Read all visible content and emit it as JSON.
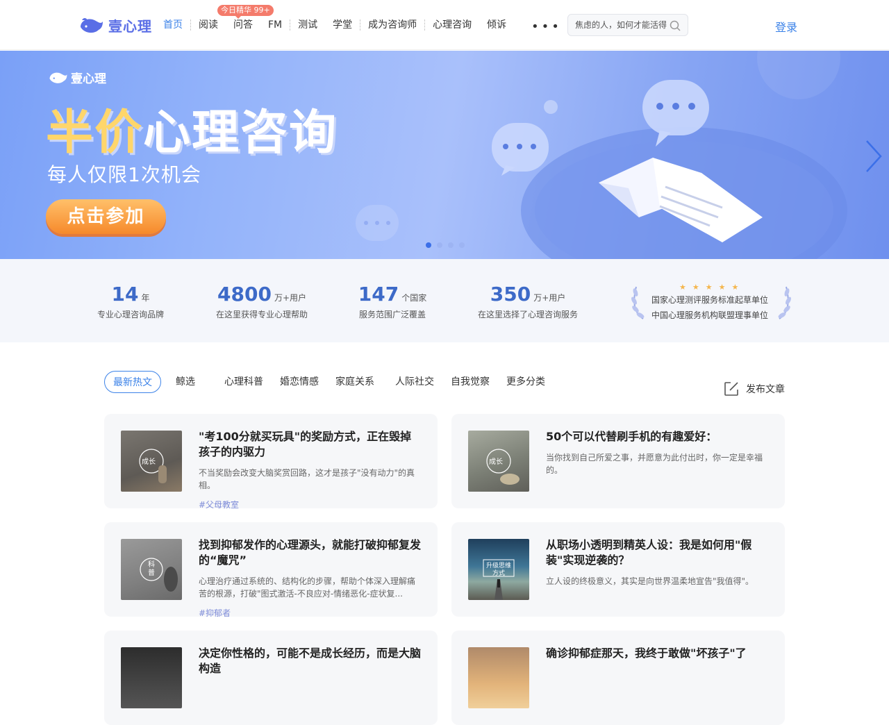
{
  "header": {
    "logo_text": "壹心理",
    "nav": [
      {
        "label": "首页",
        "active": true
      },
      {
        "label": "阅读"
      },
      {
        "label": "问答"
      },
      {
        "label": "FM"
      },
      {
        "label": "测试"
      },
      {
        "label": "学堂"
      },
      {
        "label": "成为咨询师"
      },
      {
        "label": "心理咨询"
      },
      {
        "label": "倾诉"
      }
    ],
    "badge": "今日精华 99+",
    "more": "•••",
    "search_placeholder": "焦虑的人，如何才能活得",
    "login": "登录"
  },
  "banner": {
    "logo_text": "壹心理",
    "headline_a": "半价",
    "headline_b": "心理咨询",
    "subtitle": "每人仅限1次机会",
    "cta": "点击参加",
    "dots": 4,
    "active_dot": 1
  },
  "stats": [
    {
      "num": "14",
      "unit": "年",
      "desc": "专业心理咨询品牌"
    },
    {
      "num": "4800",
      "unit": "万+用户",
      "desc": "在这里获得专业心理帮助"
    },
    {
      "num": "147",
      "unit": "个国家",
      "desc": "服务范围广泛覆盖"
    },
    {
      "num": "350",
      "unit": "万+用户",
      "desc": "在这里选择了心理咨询服务"
    }
  ],
  "awards": {
    "stars": "★★★★★",
    "lines": [
      "国家心理测评服务标准起草单位",
      "中国心理服务机构联盟理事单位"
    ]
  },
  "tabs": [
    "最新热文",
    "鲸选",
    "心理科普",
    "婚恋情感",
    "家庭关系",
    "人际社交",
    "自我觉察",
    "更多分类"
  ],
  "publish_label": "发布文章",
  "articles": [
    {
      "title": "\"考100分就买玩具\"的奖励方式，正在毁掉孩子的内驱力",
      "desc": "不当奖励会改变大脑奖赏回路，这才是孩子\"没有动力\"的真相。",
      "tag": "#父母教室",
      "img_label": "成长",
      "img_color": "#6f6b66"
    },
    {
      "title": "50个可以代替刷手机的有趣爱好：",
      "desc": "当你找到自己所爱之事，并愿意为此付出时，你一定是幸福的。",
      "tag": "",
      "img_label": "成长",
      "img_color": "#8a8f86"
    },
    {
      "title": "找到抑郁发作的心理源头，就能打破抑郁复发的“魔咒”",
      "desc": "心理治疗通过系统的、结构化的步骤，帮助个体深入理解痛苦的根源，打破\"图式激活-不良应对-情绪恶化-症状复...",
      "tag": "#抑郁者",
      "img_label": "科普",
      "img_color": "#8c8c8c"
    },
    {
      "title": "从职场小透明到精英人设：我是如何用\"假装\"实现逆袭的？",
      "desc": "立人设的终极意义，其实是向世界温柔地宣告\"我值得\"。",
      "tag": "",
      "img_label": "升级思维方式",
      "img_color": "#3d6e8f"
    },
    {
      "title": "决定你性格的，可能不是成长经历，而是大脑构造",
      "desc": "",
      "tag": "",
      "img_label": "",
      "img_color": "#3a3a3a"
    },
    {
      "title": "确诊抑郁症那天，我终于敢做\"坏孩子\"了",
      "desc": "",
      "tag": "",
      "img_label": "",
      "img_color": "#c79b6e"
    }
  ]
}
